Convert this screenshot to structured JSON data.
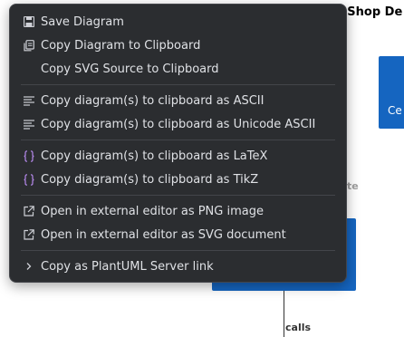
{
  "background": {
    "title_fragment": "pShop De",
    "box_right_label_fragment": "Ce",
    "side_label_fragment": "te",
    "calls_label": "calls"
  },
  "menu": {
    "groups": [
      {
        "items": [
          {
            "label": "Save Diagram",
            "icon": "save-icon"
          },
          {
            "label": "Copy Diagram to Clipboard",
            "icon": "copy-icon"
          },
          {
            "label": "Copy SVG Source to Clipboard",
            "icon": ""
          }
        ]
      },
      {
        "items": [
          {
            "label": "Copy diagram(s) to clipboard as ASCII",
            "icon": "text-lines-icon"
          },
          {
            "label": "Copy diagram(s) to clipboard as Unicode ASCII",
            "icon": "text-lines-icon"
          }
        ]
      },
      {
        "items": [
          {
            "label": "Copy diagram(s) to clipboard as LaTeX",
            "icon": "braces-icon"
          },
          {
            "label": "Copy diagram(s) to clipboard as TikZ",
            "icon": "braces-icon"
          }
        ]
      },
      {
        "items": [
          {
            "label": "Open in external editor as PNG image",
            "icon": "external-link-icon"
          },
          {
            "label": "Open in external editor as SVG document",
            "icon": "external-link-icon"
          }
        ]
      },
      {
        "items": [
          {
            "label": "Copy as PlantUML Server link",
            "icon": "chevron-right-icon"
          }
        ]
      }
    ]
  },
  "colors": {
    "menu_background": "#2b2d30",
    "menu_text": "#dfe1e5",
    "braces_icon": "#b589ec",
    "diagram_box": "#1565c0"
  }
}
